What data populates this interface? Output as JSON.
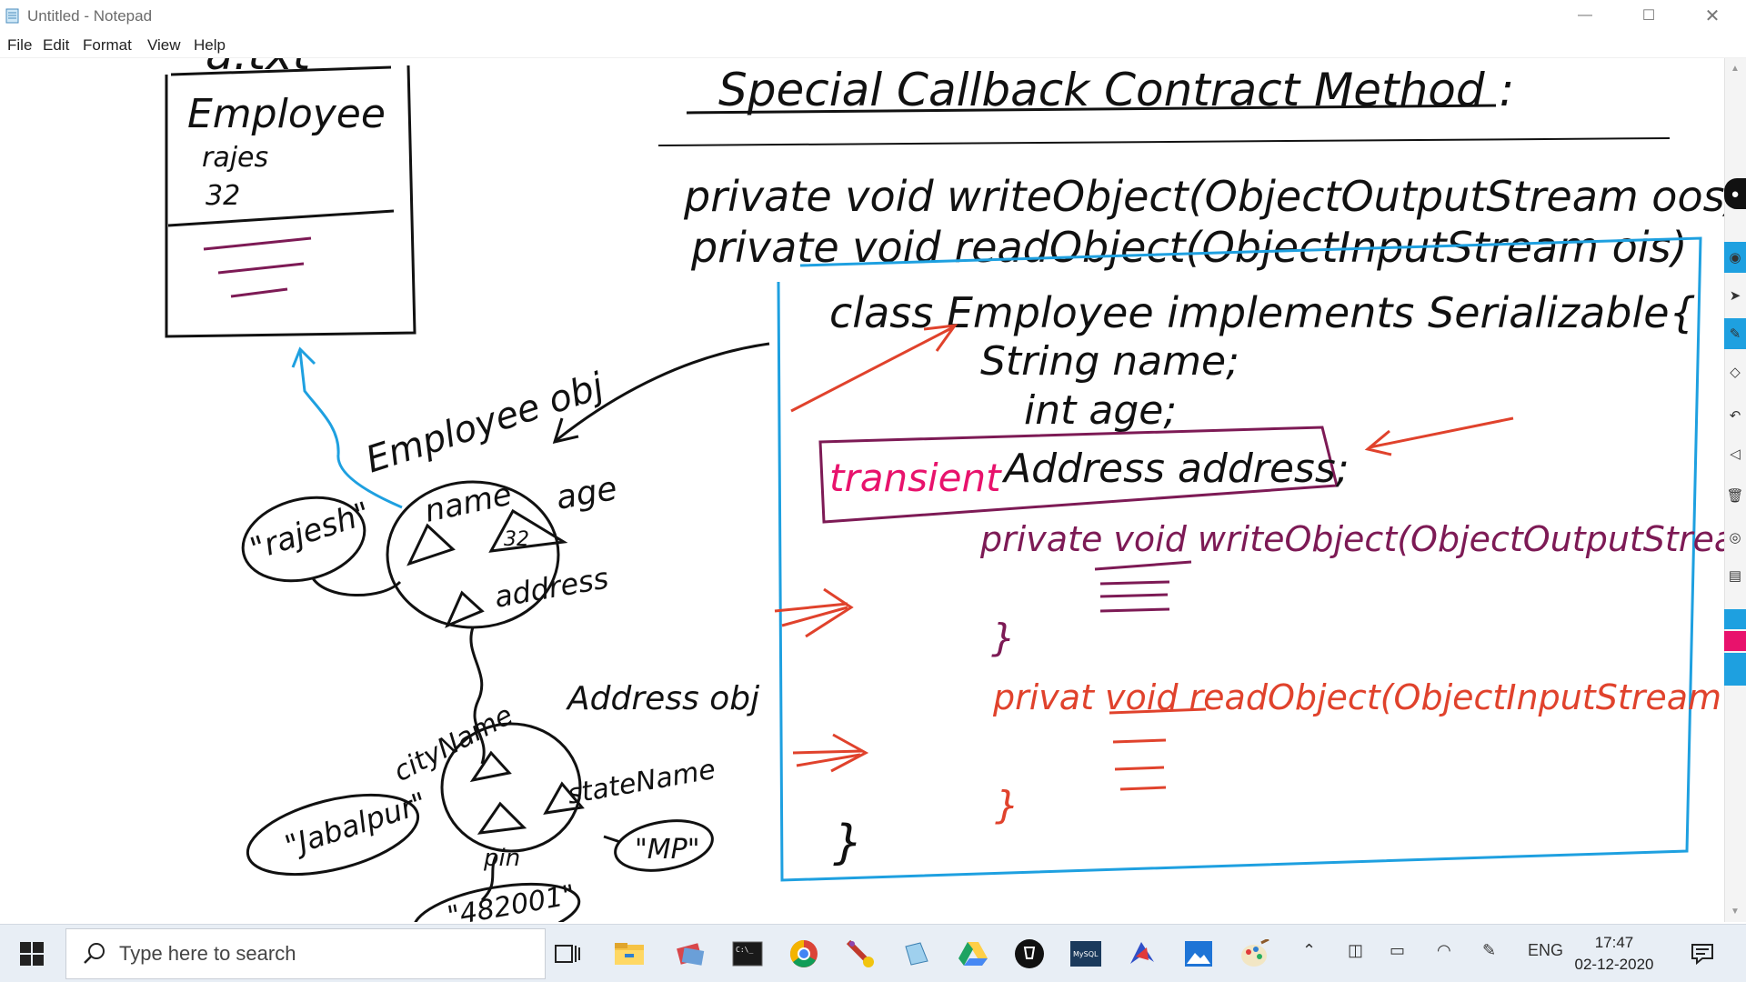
{
  "window": {
    "title": "Untitled - Notepad",
    "controls": {
      "minimize": "—",
      "maximize": "☐",
      "close": "✕"
    }
  },
  "menu": {
    "items": [
      "File",
      "Edit",
      "Format",
      "View",
      "Help"
    ]
  },
  "handwriting": {
    "file_label": "a.txt",
    "file_box": {
      "class_name": "Employee",
      "name_value": "rajes",
      "age_value": "32"
    },
    "heading": "Special Callback Contract Method :",
    "method_write": "private   void   writeObject(ObjectOutputStream  oos)",
    "method_read": "private   void   readObject(ObjectInputStream  ois)",
    "class_decl": "class  Employee  implements  Serializable{",
    "field_name": "String  name;",
    "field_age": "int   age;",
    "transient_kw": "transient",
    "transient_field": "Address  address;",
    "inner_write": "private  void  writeObject(ObjectOutputStream o){",
    "inner_read": "privat  void  readObject(ObjectInputStream o){",
    "brace_close": "}",
    "emp_obj_label": "Employee obj",
    "emp_name_field": "name",
    "emp_age_field": "age",
    "emp_age_value": "32",
    "emp_address_field": "address",
    "emp_name_value": "\"rajesh\"",
    "addr_obj_label": "Address obj",
    "addr_city_field": "cityName",
    "addr_state_field": "stateName",
    "addr_pin_field": "pin",
    "addr_city_value": "\"Jabalpur\"",
    "addr_state_value": "\"MP\"",
    "addr_pin_value": "\"482001\""
  },
  "taskbar": {
    "search_placeholder": "Type here to search",
    "language": "ENG",
    "time": "17:47",
    "date": "02-12-2020"
  },
  "colors": {
    "ink_black": "#111111",
    "ink_blue": "#1ea0e0",
    "ink_red": "#e0422c",
    "ink_purple": "#7d1a55",
    "ink_magenta": "#e8126c"
  }
}
